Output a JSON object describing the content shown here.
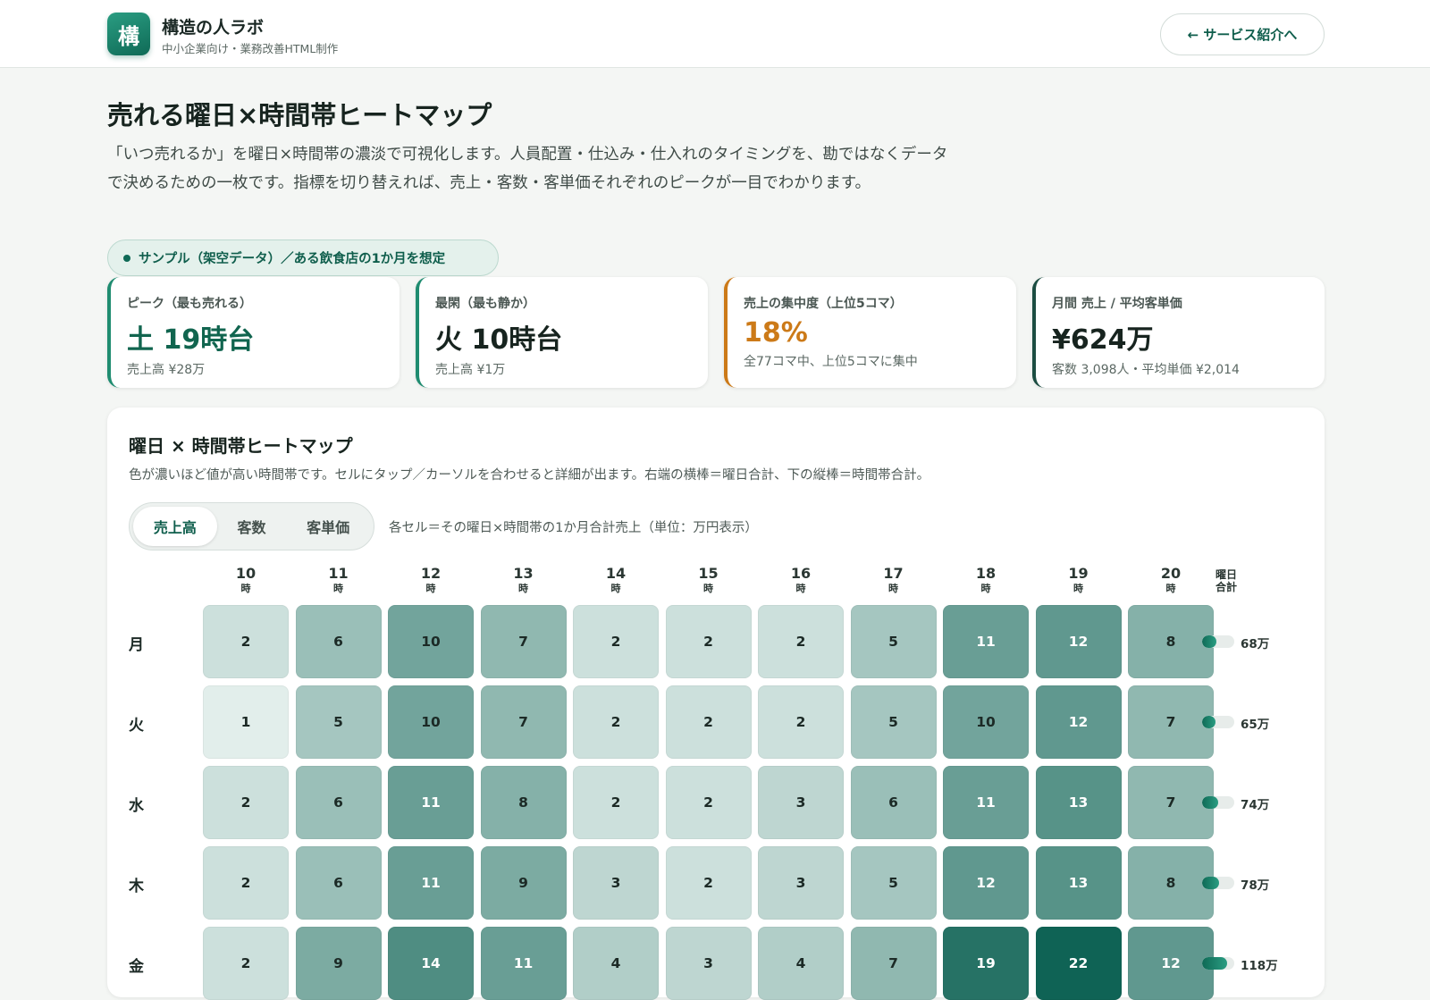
{
  "header": {
    "logo_char": "構",
    "brand_name": "構造の人ラボ",
    "brand_sub": "中小企業向け・業務改善HTML制作",
    "back_button": "← サービス紹介へ"
  },
  "page": {
    "title": "売れる曜日×時間帯ヒートマップ",
    "lead": "「いつ売れるか」を曜日×時間帯の濃淡で可視化します。人員配置・仕込み・仕入れのタイミングを、勘ではなくデータで決めるための一枚です。指標を切り替えれば、売上・客数・客単価それぞれのピークが一目でわかります。",
    "sample_pill": "サンプル（架空データ）／ある飲食店の1か月を想定"
  },
  "kpis": [
    {
      "label": "ピーク（最も売れる）",
      "value": "土 19時台",
      "sub": "売上高 ¥28万"
    },
    {
      "label": "最閑（最も静か）",
      "value": "火 10時台",
      "sub": "売上高 ¥1万"
    },
    {
      "label": "売上の集中度（上位5コマ）",
      "value": "18%",
      "sub": "全77コマ中、上位5コマに集中"
    },
    {
      "label": "月間 売上 / 平均客単価",
      "value": "¥624万",
      "sub": "客数 3,098人・平均単価 ¥2,014"
    }
  ],
  "heatmap": {
    "title": "曜日 × 時間帯ヒートマップ",
    "desc": "色が濃いほど値が高い時間帯です。セルにタップ／カーソルを合わせると詳細が出ます。右端の横棒＝曜日合計、下の縦棒＝時間帯合計。",
    "tabs": [
      "売上高",
      "客数",
      "客単価"
    ],
    "active_tab": "売上高",
    "note": "各セル＝その曜日×時間帯の1か月合計売上（単位：万円表示）",
    "hour_suffix": "時",
    "total_header_1": "曜日",
    "total_header_2": "合計",
    "colors": {
      "low": "#e2eeeb",
      "high": "#0f6355"
    }
  },
  "chart_data": {
    "type": "heatmap",
    "x": [
      "10",
      "11",
      "12",
      "13",
      "14",
      "15",
      "16",
      "17",
      "18",
      "19",
      "20"
    ],
    "y": [
      "月",
      "火",
      "水",
      "木",
      "金"
    ],
    "values": [
      [
        2,
        6,
        10,
        7,
        2,
        2,
        2,
        5,
        11,
        12,
        8
      ],
      [
        1,
        5,
        10,
        7,
        2,
        2,
        2,
        5,
        10,
        12,
        7
      ],
      [
        2,
        6,
        11,
        8,
        2,
        2,
        3,
        6,
        11,
        13,
        7
      ],
      [
        2,
        6,
        11,
        9,
        3,
        2,
        3,
        5,
        12,
        13,
        8
      ],
      [
        2,
        9,
        14,
        11,
        4,
        3,
        4,
        7,
        19,
        22,
        12
      ]
    ],
    "row_totals": [
      "68万",
      "65万",
      "74万",
      "78万",
      "118万"
    ],
    "row_total_values": [
      68,
      65,
      74,
      78,
      118
    ],
    "row_total_max": 150,
    "value_range": [
      1,
      22
    ]
  }
}
